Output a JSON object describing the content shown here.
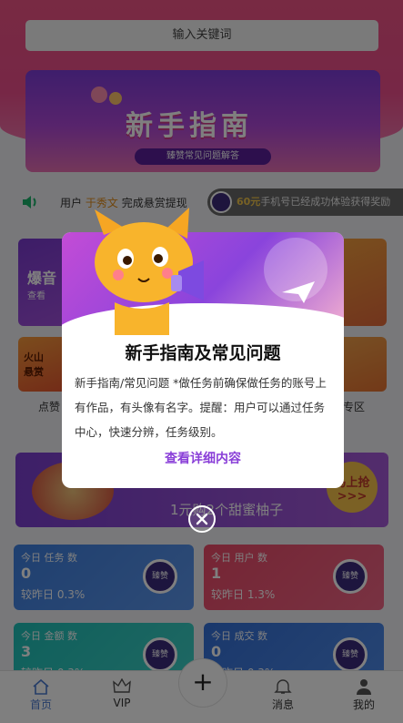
{
  "search": {
    "placeholder": "输入关键词"
  },
  "banner": {
    "title": "新手指南",
    "subtitle": "臻赞常见问题解答"
  },
  "notice": {
    "prefix": "用户",
    "user": "于秀文",
    "action": "完成悬赏提现",
    "ticker_amount": "60元",
    "ticker_text": "手机号已经成功体验获得奖励"
  },
  "categories": {
    "big1_title": "爆音",
    "big1_sub": "查看",
    "small1_title": "火山\n悬赏",
    "label1": "点赞",
    "label2": "专区"
  },
  "promo": {
    "text": "1元购2个甜蜜柚子",
    "button": "马上抢\n>>>"
  },
  "stats": [
    {
      "label": "今日 任务 数",
      "value": "0",
      "compare": "较昨日 0.3%"
    },
    {
      "label": "今日 用户 数",
      "value": "1",
      "compare": "较昨日 1.3%"
    },
    {
      "label": "今日 金额 数",
      "value": "3",
      "compare": "较昨日 0.3%"
    },
    {
      "label": "今日 成交 数",
      "value": "0",
      "compare": "较昨日 0.3%"
    }
  ],
  "stat_logo": "臻赞",
  "tabs": [
    {
      "label": "首页",
      "icon": "home-icon"
    },
    {
      "label": "VIP",
      "icon": "crown-icon"
    },
    {
      "label": "消息",
      "icon": "bell-icon"
    },
    {
      "label": "我的",
      "icon": "user-icon"
    }
  ],
  "modal": {
    "title": "新手指南及常见问题",
    "body": "新手指南/常见问题 *做任务前确保做任务的账号上有作品，有头像有名字。提醒：用户可以通过任务中心，快速分辨，任务级别。",
    "link": "查看详细内容"
  },
  "colors": {
    "accent": "#8a3fd8",
    "header": "#ee4e8c",
    "tab_active": "#4a7bd0"
  }
}
